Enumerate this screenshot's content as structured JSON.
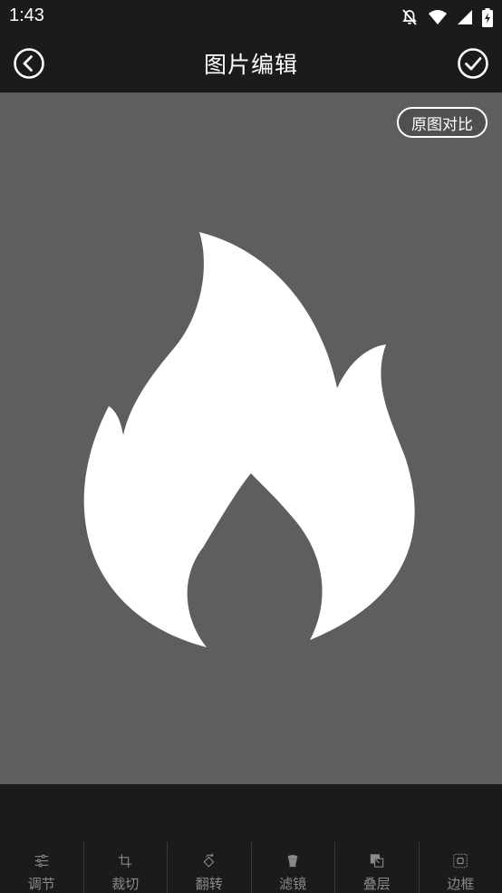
{
  "status_bar": {
    "time": "1:43",
    "icons": [
      "notifications-off-icon",
      "wifi-icon",
      "cellular-signal-icon",
      "battery-charging-icon"
    ]
  },
  "app_bar": {
    "title": "图片编辑",
    "back_icon": "back-arrow-icon",
    "confirm_icon": "check-icon"
  },
  "canvas": {
    "compare_label": "原图对比",
    "background_color": "#5e5e5e",
    "image": "flame-icon"
  },
  "toolbar": {
    "tools": [
      {
        "label": "调节",
        "icon": "adjust-sliders-icon"
      },
      {
        "label": "裁切",
        "icon": "crop-icon"
      },
      {
        "label": "翻转",
        "icon": "rotate-icon"
      },
      {
        "label": "滤镜",
        "icon": "filter-icon"
      },
      {
        "label": "叠层",
        "icon": "overlay-icon"
      },
      {
        "label": "边框",
        "icon": "frame-icon"
      }
    ]
  },
  "colors": {
    "bar_background": "#1b1b1d",
    "canvas_background": "#5e5e5e",
    "tool_icon": "#8a8a8a"
  }
}
